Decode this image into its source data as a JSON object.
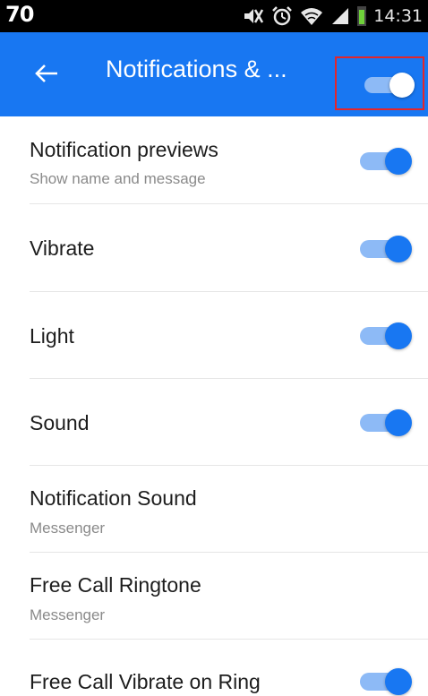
{
  "status_bar": {
    "left_text": "70",
    "time": "14:31",
    "icons": [
      "mute-icon",
      "alarm-icon",
      "wifi-icon",
      "signal-icon",
      "battery-icon"
    ]
  },
  "app_bar": {
    "title": "Notifications & ...",
    "back_icon": "arrow-left-icon",
    "master_toggle": {
      "on": true
    }
  },
  "step_marker": "3",
  "colors": {
    "accent": "#1877f2",
    "switch_track": "#8dbaf6",
    "highlight": "#e3262b"
  },
  "settings": [
    {
      "title": "Notification previews",
      "subtitle": "Show name and message",
      "toggle": true
    },
    {
      "title": "Vibrate",
      "toggle": true
    },
    {
      "title": "Light",
      "toggle": true
    },
    {
      "title": "Sound",
      "toggle": true
    },
    {
      "title": "Notification Sound",
      "subtitle": "Messenger"
    },
    {
      "title": "Free Call Ringtone",
      "subtitle": "Messenger"
    },
    {
      "title": "Free Call Vibrate on Ring",
      "toggle": true
    }
  ]
}
